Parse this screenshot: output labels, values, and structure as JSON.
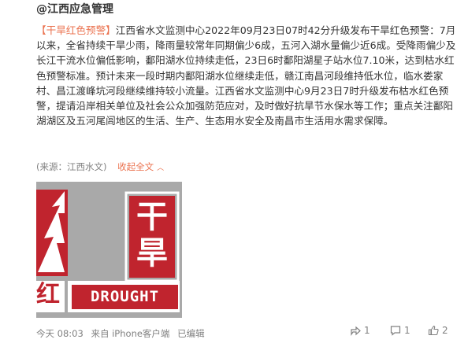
{
  "post": {
    "author": "@江西应急管理",
    "hashtag": "【干旱红色预警】",
    "text": "江西省水文监测中心2022年09月23日07时42分升级发布干旱红色预警：7月以来，全省持续干旱少雨，降雨量较常年同期偏少6成，五河入湖水量偏少近6成。受降雨偏少及长江干流水位偏低影响，鄱阳湖水位持续走低，23日6时鄱阳湖星子站水位7.10米，达到枯水红色预警标准。预计未来一段时期内鄱阳湖水位继续走低，赣江南昌河段维持低水位，临水娄家村、昌江渡峰坑河段继续维持较小流量。江西省水文监测中心9月23日7时升级发布枯水红色预警，提请沿岸相关单位及社会公众加强防范应对，及时做好抗旱节水保水等工作；重点关注鄱阳湖湖区及五河尾闾地区的生活、生产、生态用水安全及南昌市生活用水需求保障。",
    "source": "(来源：江西水文)",
    "collapse_label": "收起全文",
    "image": {
      "char_top": "干",
      "char_bottom": "旱",
      "char_red": "红",
      "label": "DROUGHT",
      "watermark": "@江西应急管理"
    },
    "meta": {
      "time": "今天 08:03",
      "device": "来自 iPhone客户端",
      "edited": "已编辑"
    },
    "actions": {
      "share_count": "1",
      "comment_count": "1",
      "like_count": "2"
    }
  },
  "colors": {
    "accent": "#eb7350",
    "warning_red": "#c0242e",
    "frame_grey": "#a9a9a9"
  }
}
